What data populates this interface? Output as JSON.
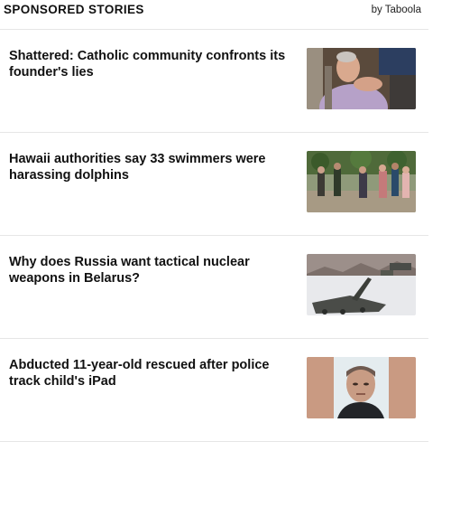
{
  "header": {
    "title": "SPONSORED STORIES",
    "attribution": "by Taboola"
  },
  "stories": [
    {
      "headline": "Shattered: Catholic community confronts its founder's lies",
      "thumbnail": "elderly-man-portrait"
    },
    {
      "headline": "Hawaii authorities say 33 swimmers were harassing dolphins",
      "thumbnail": "swimmers-group-photo"
    },
    {
      "headline": "Why does Russia want tactical nuclear weapons in Belarus?",
      "thumbnail": "missile-launchers-snow"
    },
    {
      "headline": "Abducted 11-year-old rescued after police track child's iPad",
      "thumbnail": "mugshot-portrait"
    }
  ],
  "colors": {
    "divider": "#e6e6e6",
    "text": "#111111"
  }
}
